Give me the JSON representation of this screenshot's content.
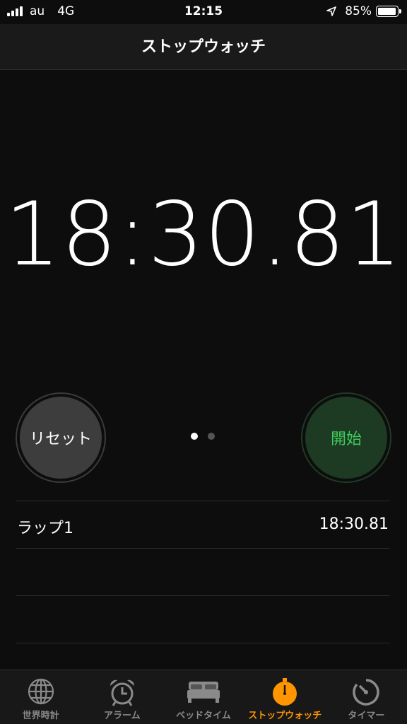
{
  "status_bar": {
    "carrier": "au",
    "network": "4G",
    "time": "12:15",
    "battery": "85%"
  },
  "nav": {
    "title": "ストップウォッチ"
  },
  "stopwatch": {
    "time": "18:30.81"
  },
  "buttons": {
    "reset": "リセット",
    "start": "開始"
  },
  "laps": [
    {
      "label": "ラップ1",
      "time": "18:30.81"
    }
  ],
  "tabs": [
    {
      "label": "世界時計",
      "icon": "globe-icon"
    },
    {
      "label": "アラーム",
      "icon": "alarm-clock-icon"
    },
    {
      "label": "ベッドタイム",
      "icon": "bed-icon"
    },
    {
      "label": "ストップウォッチ",
      "icon": "stopwatch-icon",
      "active": true
    },
    {
      "label": "タイマー",
      "icon": "timer-icon"
    }
  ],
  "colors": {
    "accent": "#ff9500",
    "start_green": "#3ecd5d"
  }
}
